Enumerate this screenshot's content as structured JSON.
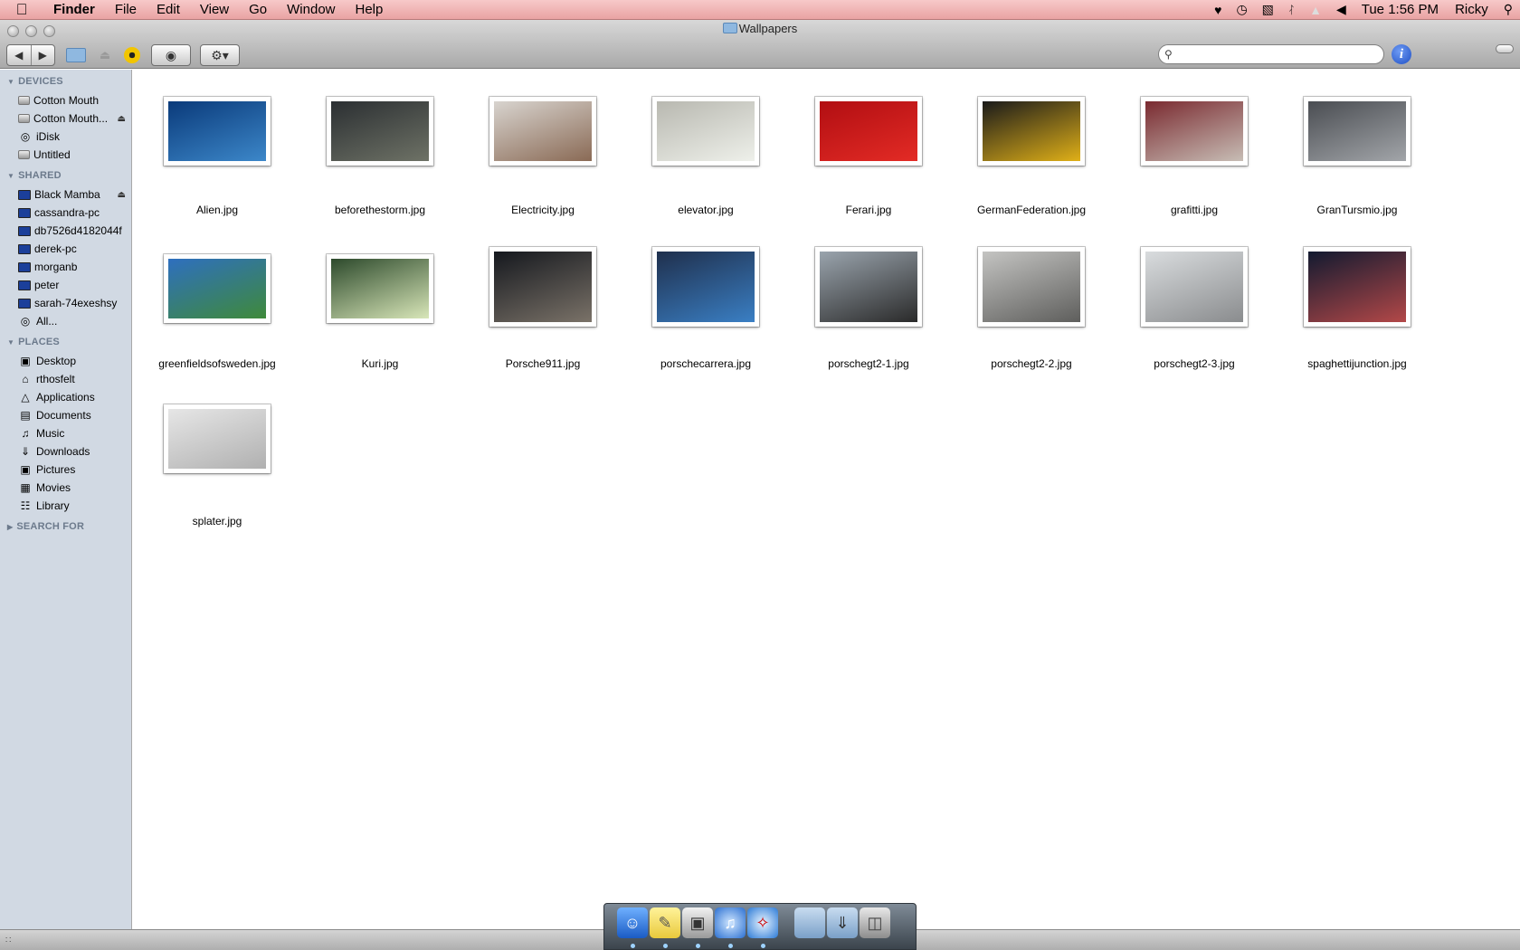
{
  "menubar": {
    "apple": "",
    "items": [
      "Finder",
      "File",
      "Edit",
      "View",
      "Go",
      "Window",
      "Help"
    ],
    "status_icons": [
      "heart-icon",
      "time-machine-icon",
      "display-icon",
      "bluetooth-icon",
      "wifi-icon",
      "volume-icon"
    ],
    "clock": "Tue 1:56 PM",
    "user": "Ricky"
  },
  "window": {
    "title": "Wallpapers"
  },
  "search": {
    "placeholder": "",
    "value": ""
  },
  "sidebar": {
    "sections": [
      {
        "title": "DEVICES",
        "items": [
          {
            "label": "Cotton Mouth",
            "icon": "hard-drive-icon"
          },
          {
            "label": "Cotton Mouth...",
            "icon": "hard-drive-icon",
            "eject": true
          },
          {
            "label": "iDisk",
            "icon": "idisk-icon"
          },
          {
            "label": "Untitled",
            "icon": "hard-drive-icon"
          }
        ]
      },
      {
        "title": "SHARED",
        "items": [
          {
            "label": "Black Mamba",
            "icon": "computer-icon",
            "eject": true
          },
          {
            "label": "cassandra-pc",
            "icon": "computer-icon"
          },
          {
            "label": "db7526d4182044f",
            "icon": "computer-icon"
          },
          {
            "label": "derek-pc",
            "icon": "computer-icon"
          },
          {
            "label": "morganb",
            "icon": "computer-icon"
          },
          {
            "label": "peter",
            "icon": "computer-icon"
          },
          {
            "label": "sarah-74exeshsy",
            "icon": "computer-icon"
          },
          {
            "label": "All...",
            "icon": "network-icon"
          }
        ]
      },
      {
        "title": "PLACES",
        "items": [
          {
            "label": "Desktop",
            "icon": "desktop-icon"
          },
          {
            "label": "rthosfelt",
            "icon": "home-icon"
          },
          {
            "label": "Applications",
            "icon": "applications-icon"
          },
          {
            "label": "Documents",
            "icon": "documents-icon"
          },
          {
            "label": "Music",
            "icon": "music-icon"
          },
          {
            "label": "Downloads",
            "icon": "downloads-icon"
          },
          {
            "label": "Pictures",
            "icon": "pictures-icon"
          },
          {
            "label": "Movies",
            "icon": "movies-icon"
          },
          {
            "label": "Library",
            "icon": "library-icon"
          }
        ]
      },
      {
        "title": "SEARCH FOR",
        "collapsed": true,
        "items": []
      }
    ]
  },
  "files": [
    {
      "name": "Alien.jpg",
      "colors": [
        "#0a3a7a",
        "#3c87c9"
      ]
    },
    {
      "name": "beforethestorm.jpg",
      "colors": [
        "#2b2f32",
        "#6e7266"
      ]
    },
    {
      "name": "Electricity.jpg",
      "colors": [
        "#d8d4cf",
        "#8a6a55"
      ]
    },
    {
      "name": "elevator.jpg",
      "colors": [
        "#b8b8b0",
        "#eef0ea"
      ]
    },
    {
      "name": "Ferari.jpg",
      "colors": [
        "#b10e12",
        "#e32b25"
      ]
    },
    {
      "name": "GermanFederation.jpg",
      "colors": [
        "#1a1a1a",
        "#e0b018"
      ]
    },
    {
      "name": "grafitti.jpg",
      "colors": [
        "#7a2a30",
        "#c7bdb5"
      ]
    },
    {
      "name": "GranTursmio.jpg",
      "colors": [
        "#4a4d52",
        "#a2a5a9"
      ]
    },
    {
      "name": "greenfieldsofsweden.jpg",
      "colors": [
        "#2e6fbf",
        "#3f8a3a"
      ]
    },
    {
      "name": "Kuri.jpg",
      "colors": [
        "#2d4a2c",
        "#d8e6b8"
      ]
    },
    {
      "name": "Porsche911.jpg",
      "colors": [
        "#15181e",
        "#7a7268"
      ]
    },
    {
      "name": "porschecarrera.jpg",
      "colors": [
        "#1f2f4c",
        "#3a7fc4"
      ]
    },
    {
      "name": "porschegt2-1.jpg",
      "colors": [
        "#9aa4ad",
        "#2a2a2a"
      ]
    },
    {
      "name": "porschegt2-2.jpg",
      "colors": [
        "#c4c4c2",
        "#5e5e5c"
      ]
    },
    {
      "name": "porschegt2-3.jpg",
      "colors": [
        "#d9dcde",
        "#8a8c8e"
      ]
    },
    {
      "name": "spaghettijunction.jpg",
      "colors": [
        "#121a30",
        "#b34848"
      ]
    },
    {
      "name": "splater.jpg",
      "colors": [
        "#e6e6e6",
        "#b0b0b0"
      ]
    }
  ],
  "dock": {
    "items": [
      "finder-icon",
      "stickies-icon",
      "preview-icon",
      "itunes-icon",
      "safari-icon",
      "documents-stack-icon",
      "downloads-stack-icon",
      "trash-icon"
    ]
  }
}
